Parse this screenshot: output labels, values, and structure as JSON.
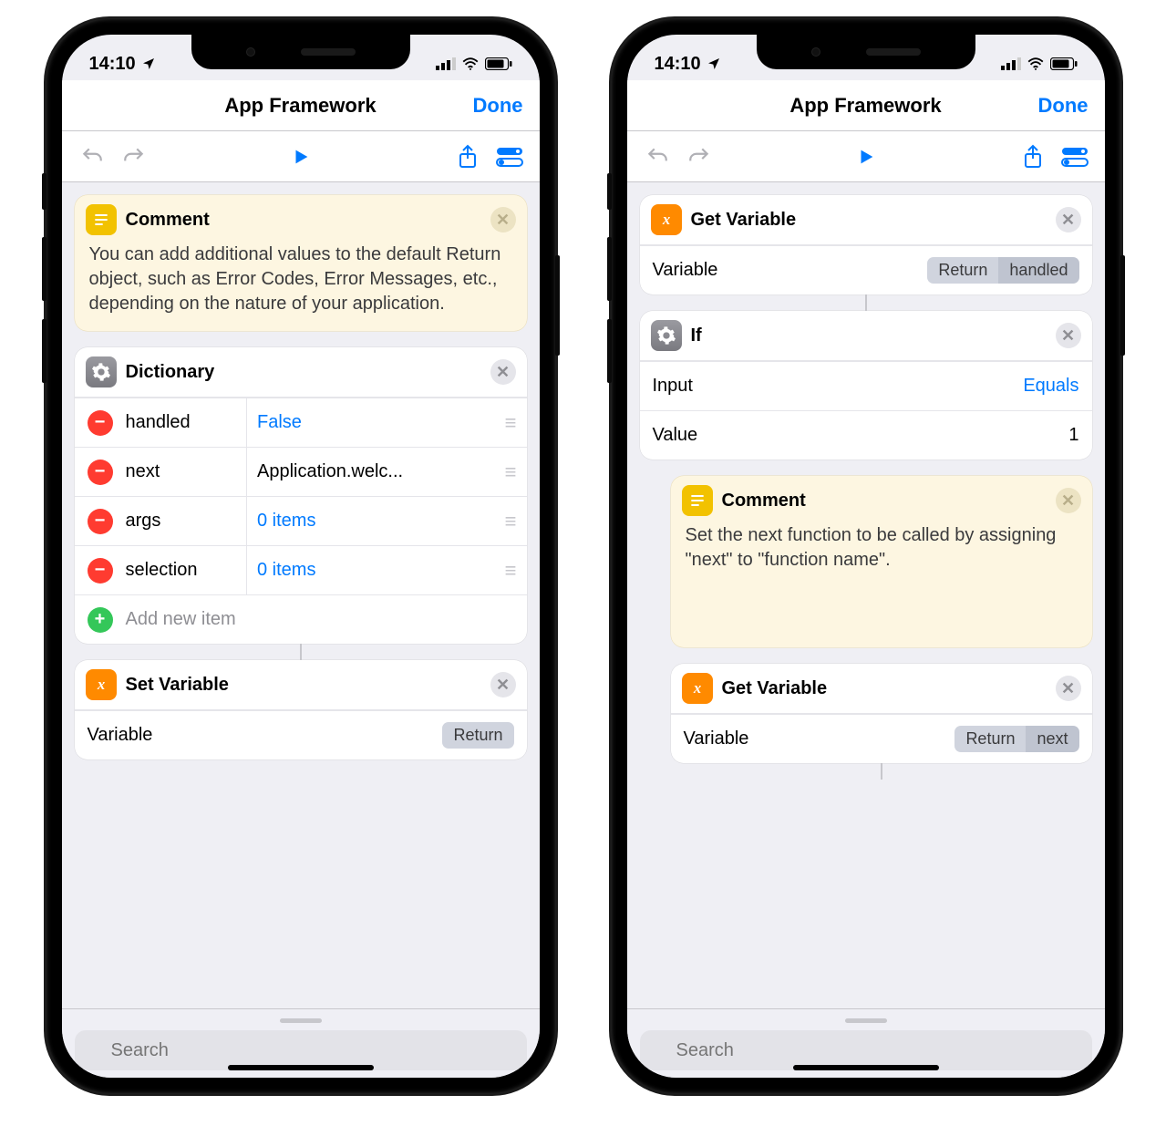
{
  "status": {
    "time": "14:10"
  },
  "nav": {
    "title": "App Framework",
    "done": "Done"
  },
  "search": {
    "placeholder": "Search"
  },
  "left": {
    "comment": {
      "title": "Comment",
      "body": "You can add additional values to the default Return object, such as Error Codes, Error Messages, etc., depending on the nature of your application."
    },
    "dictionary": {
      "title": "Dictionary",
      "rows": [
        {
          "key": "handled",
          "value": "False",
          "link": true
        },
        {
          "key": "next",
          "value": "Application.welc...",
          "link": false
        },
        {
          "key": "args",
          "value": "0 items",
          "link": true
        },
        {
          "key": "selection",
          "value": "0 items",
          "link": true
        }
      ],
      "add": "Add new item"
    },
    "setvar": {
      "title": "Set Variable",
      "label": "Variable",
      "token": "Return"
    }
  },
  "right": {
    "getvar1": {
      "title": "Get Variable",
      "label": "Variable",
      "token1": "Return",
      "token2": "handled"
    },
    "ifcard": {
      "title": "If",
      "inputLabel": "Input",
      "inputValue": "Equals",
      "valueLabel": "Value",
      "valueValue": "1"
    },
    "comment": {
      "title": "Comment",
      "body": "Set the next function to be called by assigning \"next\" to \"function name\"."
    },
    "getvar2": {
      "title": "Get Variable",
      "label": "Variable",
      "token1": "Return",
      "token2": "next"
    }
  }
}
